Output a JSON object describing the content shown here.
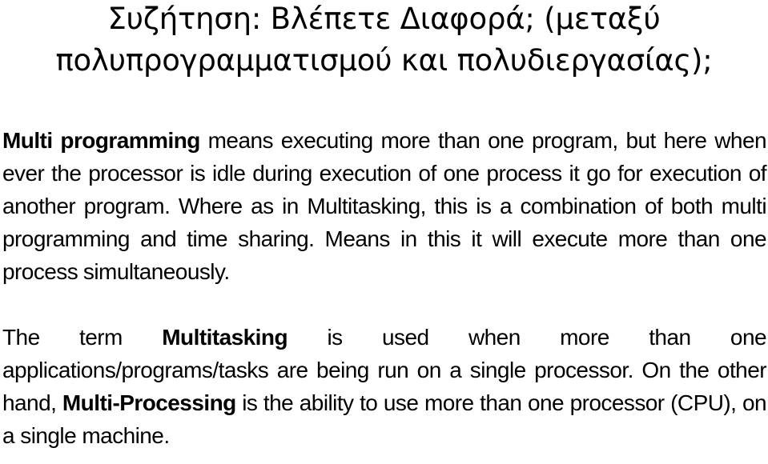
{
  "slide": {
    "background_color": "#ffffff",
    "text_color": "#000000",
    "title": "Συζήτηση: Βλέπετε Διαφορά; (μεταξύ\nπολυπρογραμματισμού και πολυδιεργασίας);",
    "title_lines": [
      "Συζήτηση: Βλέπετε Διαφορά; (μεταξύ",
      "πολυπρογραμματισμού και πολυδιεργασίας);"
    ],
    "paragraphs": [
      {
        "id": "paragraph-1",
        "bold_lead": "Multi programming",
        "rest": " means executing more than one program, but here when ever the processor is idle during execution of one process it go for execution of another program. Where as in Multitasking, this is a combination of both multi programming and time sharing. Means in this it will execute more than one process simultaneously.",
        "full_text": "Multi programming means executing more than one program, but here when ever the processor is idle during execution of one process it go for execution of another program. Where as in Multitasking, this is a combination of both multi programming and time sharing. Means in this it will execute more than one process simultaneously.",
        "lines": [
          "Multi programming means executing more than one program, but",
          "here when ever the processor is idle during execution of one process",
          "it go for execution of another program. Where as in Multitasking, this",
          "is a combination of both multi programming and time sharing. Means",
          "in this it will execute more than one process simultaneously."
        ]
      },
      {
        "id": "paragraph-2",
        "segment_1": "The term ",
        "bold_1": "Multitasking",
        "segment_2": " is used when more than one applications/programs/tasks are being run on a single processor. On the other hand, ",
        "bold_2": "Multi-Processing",
        "segment_3": " is the ability to use more than one processor (CPU), on a single machine.",
        "full_text": "The term Multitasking is used when more than one applications/programs/tasks are being run on a single processor. On the other hand, Multi-Processing is the ability to use more than one processor (CPU), on a single machine.",
        "lines": [
          "The term Multitasking is used when more than one",
          "applications/programs/tasks are being run on a single processor. On",
          "the other hand, Multi-Processing is the ability to use more than one",
          "processor (CPU), on a single machine."
        ]
      }
    ]
  }
}
